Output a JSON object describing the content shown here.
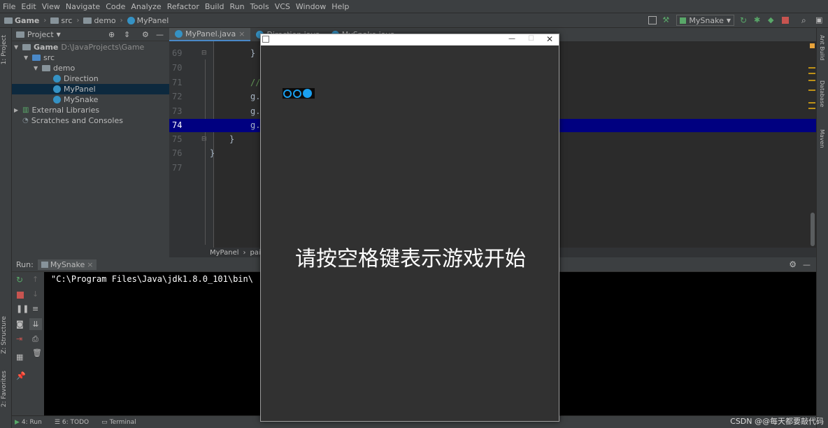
{
  "menu": [
    "File",
    "Edit",
    "View",
    "Navigate",
    "Code",
    "Analyze",
    "Refactor",
    "Build",
    "Run",
    "Tools",
    "VCS",
    "Window",
    "Help"
  ],
  "nav": {
    "project": "Game",
    "src": "src",
    "pkg": "demo",
    "file": "MyPanel",
    "run_config": "MySnake"
  },
  "project_panel": {
    "title": "Project",
    "tree": [
      {
        "label": "Game",
        "extra": "D:\\JavaProjects\\Game"
      },
      {
        "label": "src"
      },
      {
        "label": "demo"
      },
      {
        "label": "Direction"
      },
      {
        "label": "MyPanel"
      },
      {
        "label": "MySnake"
      },
      {
        "label": "External Libraries"
      },
      {
        "label": "Scratches and Consoles"
      }
    ]
  },
  "left_stripe": {
    "project": "1: Project",
    "structure": "Z: Structure",
    "favorites": "2: Favorites"
  },
  "right_stripe": {
    "ant": "Ant Build",
    "database": "Database",
    "maven": "Maven"
  },
  "editor": {
    "tabs": [
      "MyPanel.java",
      "Direction.java",
      "MySnake.java"
    ],
    "line_numbers": [
      "69",
      "70",
      "71",
      "72",
      "73",
      "74",
      "75",
      "76",
      "77"
    ],
    "lines": [
      "}",
      "",
      "//",
      "g.",
      "g.",
      "g.",
      "}",
      "}",
      ""
    ],
    "breadcrumb": [
      "MyPanel",
      "pain"
    ]
  },
  "run": {
    "label": "Run:",
    "tab": "MySnake",
    "console": "\"C:\\Program Files\\Java\\jdk1.8.0_101\\bin\\"
  },
  "bottom": {
    "run": "4: Run",
    "todo": "6: TODO",
    "terminal": "Terminal"
  },
  "watermark": "CSDN @@每天都要敲代码",
  "game_window": {
    "message": "请按空格键表示游戏开始"
  },
  "colors": {
    "accent": "#4a88c7",
    "highlight": "#000080",
    "snake": "#1aa0f0",
    "console_bg": "#000000"
  }
}
